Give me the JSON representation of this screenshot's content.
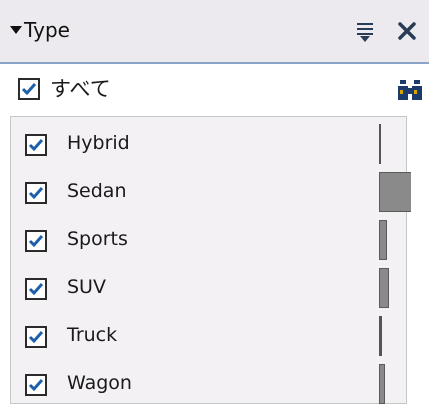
{
  "header": {
    "title": "Type",
    "collapse_icon": "caret-down-icon",
    "filter_icon": "filter-icon",
    "close_icon": "close-icon"
  },
  "select_all": {
    "label": "すべて",
    "checked": true,
    "icon": "binoculars-icon"
  },
  "items": [
    {
      "label": "Hybrid",
      "checked": true,
      "relative_value": 0.02
    },
    {
      "label": "Sedan",
      "checked": true,
      "relative_value": 1.0
    },
    {
      "label": "Sports",
      "checked": true,
      "relative_value": 0.2
    },
    {
      "label": "SUV",
      "checked": true,
      "relative_value": 0.25
    },
    {
      "label": "Truck",
      "checked": true,
      "relative_value": 0.07
    },
    {
      "label": "Wagon",
      "checked": true,
      "relative_value": 0.15
    }
  ],
  "colors": {
    "header_bg": "#eceaee",
    "accent_line": "#8aa3c6",
    "check": "#1f5fa8",
    "bar": "#8a8a8a"
  }
}
